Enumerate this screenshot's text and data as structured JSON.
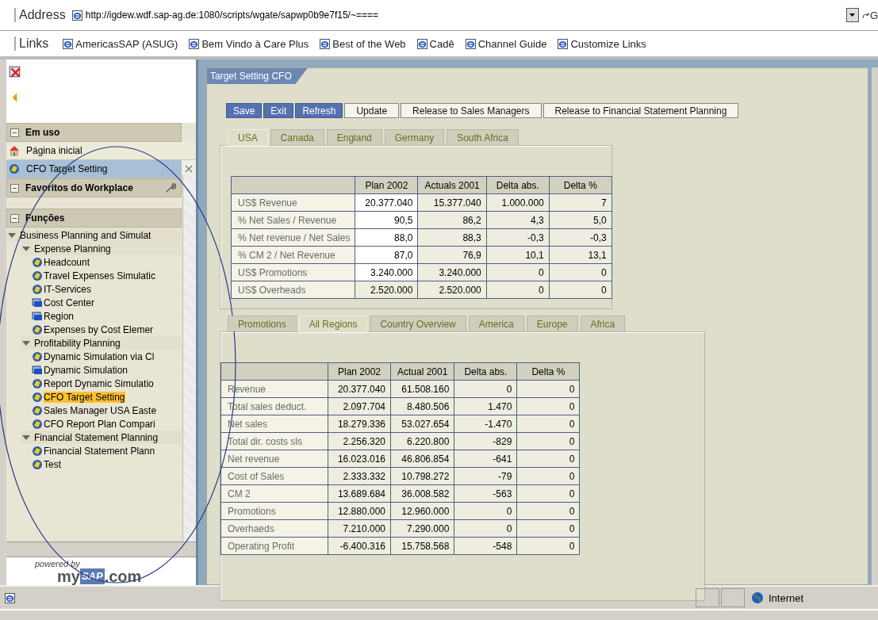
{
  "address_bar": {
    "label": "Address",
    "url": "http://igdew.wdf.sap-ag.de:1080/scripts/wgate/sapwp0b9e7f15/~====",
    "go": "G"
  },
  "links_bar": {
    "label": "Links",
    "links": [
      "AmericasSAP (ASUG)",
      "Bem Vindo à Care Plus",
      "Best of the Web",
      "Cadê",
      "Channel Guide",
      "Customize Links"
    ]
  },
  "sidebar": {
    "sections": [
      {
        "title": "Em uso",
        "expanded": true,
        "items": [
          {
            "label": "Página inicial",
            "kind": "home",
            "selected": false
          },
          {
            "label": "CFO Target Setting",
            "kind": "report",
            "selected": true
          }
        ]
      },
      {
        "title": "Favoritos do Workplace",
        "expanded": true
      },
      {
        "title": "Funções",
        "expanded": true,
        "tree": [
          {
            "label": "Business Planning and Simulat",
            "expanded": true,
            "children": [
              {
                "label": "Expense Planning",
                "expanded": true,
                "children": [
                  {
                    "label": "Headcount",
                    "kind": "report",
                    "selected": false
                  },
                  {
                    "label": "Travel Expenses Simulatic",
                    "kind": "report",
                    "selected": false
                  },
                  {
                    "label": "IT-Services",
                    "kind": "report",
                    "selected": false
                  },
                  {
                    "label": "Cost Center",
                    "kind": "planning",
                    "selected": false
                  },
                  {
                    "label": "Region",
                    "kind": "planning",
                    "selected": false
                  },
                  {
                    "label": "Expenses by Cost Elemer",
                    "kind": "report",
                    "selected": false
                  }
                ]
              },
              {
                "label": "Profitability Planning",
                "expanded": true,
                "children": [
                  {
                    "label": "Dynamic Simulation via Cl",
                    "kind": "report",
                    "selected": false
                  },
                  {
                    "label": "Dynamic Simulation",
                    "kind": "planning",
                    "selected": false
                  },
                  {
                    "label": "Report Dynamic Simulatio",
                    "kind": "report",
                    "selected": false
                  },
                  {
                    "label": "CFO Target Setting",
                    "kind": "report",
                    "selected": true
                  },
                  {
                    "label": "Sales Manager USA Easte",
                    "kind": "report",
                    "selected": false
                  },
                  {
                    "label": "CFO Report Plan Compari",
                    "kind": "report",
                    "selected": false
                  }
                ]
              },
              {
                "label": "Financial Statement Planning",
                "expanded": true,
                "children": [
                  {
                    "label": "Financial Statement Plann",
                    "kind": "report",
                    "selected": false
                  },
                  {
                    "label": "Test",
                    "kind": "report",
                    "selected": false
                  }
                ]
              }
            ]
          }
        ]
      }
    ],
    "logo": {
      "caption": "powered by",
      "brand_left": "my",
      "brand_mid": "SAP",
      "brand_right": ".com"
    }
  },
  "content": {
    "title": "Target Setting CFO",
    "buttons": [
      {
        "label": "Save",
        "kind": "primary"
      },
      {
        "label": "Exit",
        "kind": "primary"
      },
      {
        "label": "Refresh",
        "kind": "primary"
      },
      {
        "label": "Update",
        "kind": "secondary"
      },
      {
        "label": "Release to Sales Managers",
        "kind": "secondary"
      },
      {
        "label": "Release to Financial Statement Planning",
        "kind": "secondary"
      }
    ],
    "country_tabs": [
      {
        "label": "USA",
        "selected": true
      },
      {
        "label": "Canada",
        "selected": false
      },
      {
        "label": "England",
        "selected": false
      },
      {
        "label": "Germany",
        "selected": false
      },
      {
        "label": "South Africa",
        "selected": false
      }
    ],
    "target_table": {
      "columns": [
        "Plan 2002",
        "Actuals 2001",
        "Delta abs.",
        "Delta %"
      ],
      "rows": [
        {
          "label": "US$ Revenue",
          "editable": true,
          "cells": [
            "20.377.040",
            "15.377.040",
            "1.000.000",
            "7"
          ]
        },
        {
          "label": "% Net Sales / Revenue",
          "editable": true,
          "cells": [
            "90,5",
            "86,2",
            "4,3",
            "5,0"
          ]
        },
        {
          "label": "% Net revenue / Net Sales",
          "editable": true,
          "cells": [
            "88,0",
            "88,3",
            "-0,3",
            "-0,3"
          ]
        },
        {
          "label": "% CM 2 / Net Revenue",
          "editable": true,
          "cells": [
            "87,0",
            "76,9",
            "10,1",
            "13,1"
          ]
        },
        {
          "label": "US$ Promotions",
          "editable": true,
          "cells": [
            "3.240.000",
            "3.240.000",
            "0",
            "0"
          ]
        },
        {
          "label": "US$ Overheads",
          "editable": false,
          "cells": [
            "2.520.000",
            "2.520.000",
            "0",
            "0"
          ]
        }
      ]
    },
    "region_tabs": [
      {
        "label": "Promotions",
        "selected": false
      },
      {
        "label": "All Regions",
        "selected": true
      },
      {
        "label": "Country Overview",
        "selected": false
      },
      {
        "label": "America",
        "selected": false
      },
      {
        "label": "Europe",
        "selected": false
      },
      {
        "label": "Africa",
        "selected": false
      }
    ],
    "region_table": {
      "columns": [
        "Plan 2002",
        "Actual 2001",
        "Delta abs.",
        "Delta %"
      ],
      "rows": [
        {
          "label": "Revenue",
          "cells": [
            "20.377.040",
            "61.508.160",
            "0",
            "0"
          ]
        },
        {
          "label": "Total sales deduct.",
          "cells": [
            "2.097.704",
            "8.480.506",
            "1.470",
            "0"
          ]
        },
        {
          "label": "Net sales",
          "cells": [
            "18.279.336",
            "53.027.654",
            "-1.470",
            "0"
          ]
        },
        {
          "label": "Total dir. costs sls",
          "cells": [
            "2.256.320",
            "6.220.800",
            "-829",
            "0"
          ]
        },
        {
          "label": "Net revenue",
          "cells": [
            "16.023.016",
            "46.806.854",
            "-641",
            "0"
          ]
        },
        {
          "label": "Cost of Sales",
          "cells": [
            "2.333.332",
            "10.798.272",
            "-79",
            "0"
          ]
        },
        {
          "label": "CM 2",
          "cells": [
            "13.689.684",
            "36.008.582",
            "-563",
            "0"
          ]
        },
        {
          "label": "Promotions",
          "cells": [
            "12.880.000",
            "12.960.000",
            "0",
            "0"
          ]
        },
        {
          "label": "Overhaeds",
          "cells": [
            "7.210.000",
            "7.290.000",
            "0",
            "0"
          ]
        },
        {
          "label": "Operating Profit",
          "cells": [
            "-6.400.316",
            "15.758.568",
            "-548",
            "0"
          ]
        }
      ]
    }
  },
  "status_bar": {
    "zone": "Internet"
  }
}
